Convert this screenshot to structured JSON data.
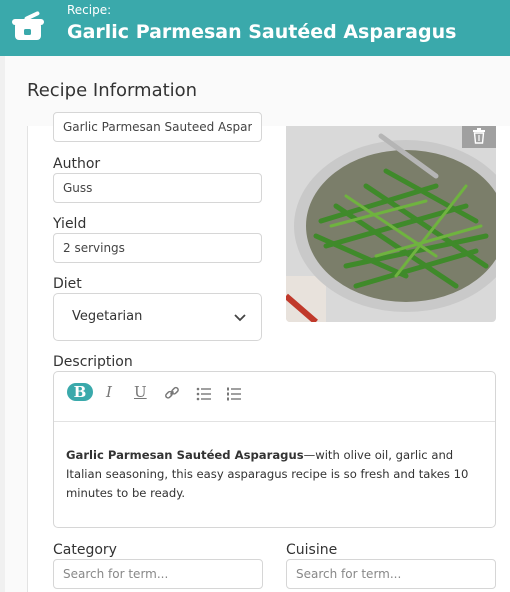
{
  "header": {
    "kicker": "Recipe:",
    "title": "Garlic Parmesan Sautéed Asparagus"
  },
  "sheet": {
    "title": "Recipe Information"
  },
  "form": {
    "name_value": "Garlic Parmesan Sauteed Asparagus",
    "author_label": "Author",
    "author_value": "Guss",
    "yield_label": "Yield",
    "yield_value": "2 servings",
    "diet_label": "Diet",
    "diet_value": "Vegetarian",
    "description_label": "Description",
    "description_bold": "Garlic Parmesan Sautéed Asparagus",
    "description_rest": "—with olive oil, garlic and Italian seasoning, this easy asparagus recipe is so fresh and takes 10 minutes to be ready.",
    "category_label": "Category",
    "category_placeholder": "Search for term...",
    "cuisine_label": "Cuisine",
    "cuisine_placeholder": "Search for term..."
  },
  "toolbar": {
    "bold": "B",
    "italic": "I",
    "underline": "U"
  },
  "colors": {
    "accent": "#3aa9ab"
  },
  "icons": [
    "pot-icon",
    "trash-icon",
    "chevron-down-icon",
    "bold-icon",
    "italic-icon",
    "underline-icon",
    "link-icon",
    "bullet-list-icon",
    "numbered-list-icon"
  ]
}
